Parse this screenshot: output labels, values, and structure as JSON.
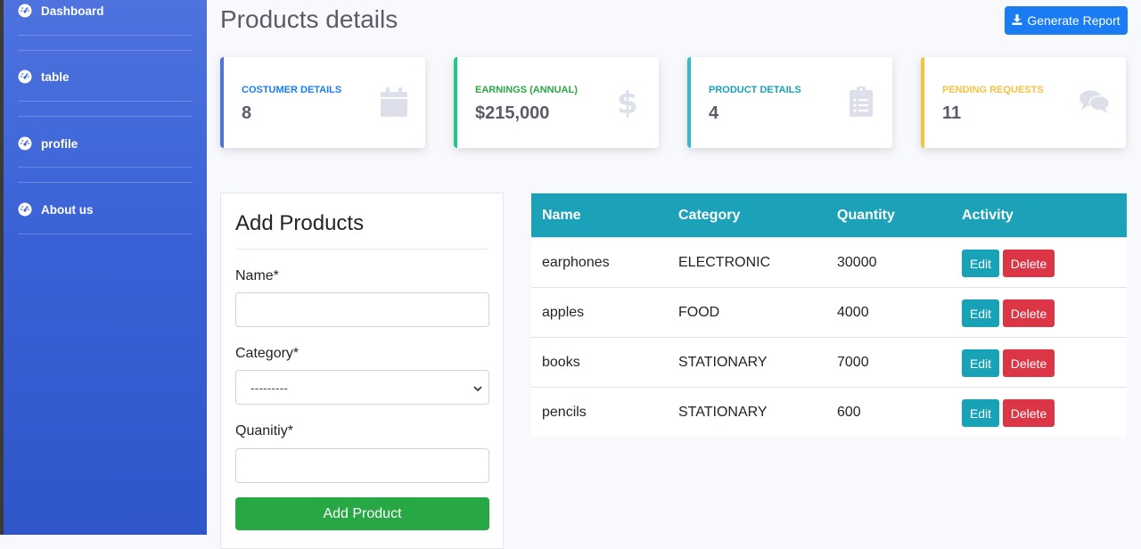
{
  "sidebar": {
    "items": [
      {
        "label": "Dashboard",
        "icon": "tachometer-icon"
      },
      {
        "label": "table",
        "icon": "tachometer-icon"
      },
      {
        "label": "profile",
        "icon": "tachometer-icon"
      },
      {
        "label": "About us",
        "icon": "tachometer-icon"
      }
    ]
  },
  "header": {
    "title": "Products details",
    "report_button": "Generate Report",
    "report_icon": "download-icon"
  },
  "cards": [
    {
      "label": "COSTUMER DETAILS",
      "value": "8",
      "color": "#4e73df",
      "label_color": "#1a7cf3",
      "icon": "calendar-icon"
    },
    {
      "label": "EARNINGS (ANNUAL)",
      "value": "$215,000",
      "color": "#1cc88a",
      "label_color": "#28a745",
      "icon": "dollar-icon"
    },
    {
      "label": "PRODUCT DETAILS",
      "value": "4",
      "color": "#36b9cc",
      "label_color": "#17a2b8",
      "icon": "clipboard-list-icon"
    },
    {
      "label": "PENDING REQUESTS",
      "value": "11",
      "color": "#f6c23e",
      "label_color": "#f6c23e",
      "icon": "comments-icon"
    }
  ],
  "form": {
    "title": "Add Products",
    "name_label": "Name*",
    "name_value": "",
    "category_label": "Category*",
    "category_value": "---------",
    "quantity_label": "Quanitiy*",
    "quantity_value": "",
    "submit_label": "Add Product"
  },
  "table": {
    "headers": [
      "Name",
      "Category",
      "Quantity",
      "Activity"
    ],
    "edit_label": "Edit",
    "delete_label": "Delete",
    "rows": [
      {
        "name": "earphones",
        "category": "ELECTRONIC",
        "quantity": "30000"
      },
      {
        "name": "apples",
        "category": "FOOD",
        "quantity": "4000"
      },
      {
        "name": "books",
        "category": "STATIONARY",
        "quantity": "7000"
      },
      {
        "name": "pencils",
        "category": "STATIONARY",
        "quantity": "600"
      }
    ]
  },
  "colors": {
    "sidebar": "#4e73df",
    "primary": "#1a7cf3",
    "success": "#28a745",
    "info": "#17a2b8",
    "danger": "#dc3545",
    "table_header": "#1ba2b9"
  }
}
